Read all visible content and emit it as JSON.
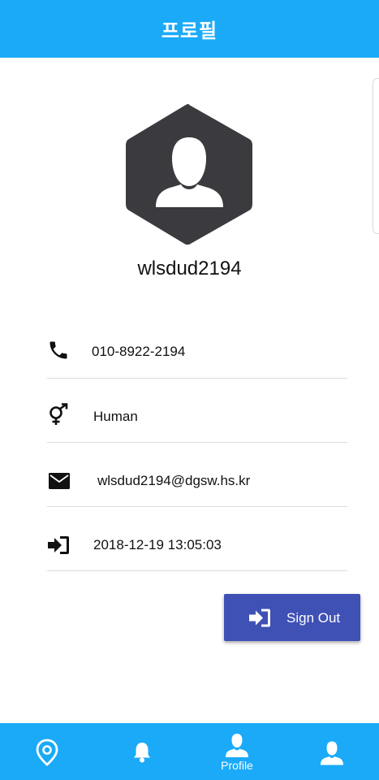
{
  "header": {
    "title": "프로필"
  },
  "profile": {
    "username": "wlsdud2194"
  },
  "details": {
    "phone": "010-8922-2194",
    "gender": "Human",
    "email": "wlsdud2194@dgsw.hs.kr",
    "last_login": "2018-12-19 13:05:03"
  },
  "actions": {
    "sign_out_label": "Sign Out"
  },
  "bottom_nav": {
    "items": [
      {
        "icon": "location-pin-icon",
        "label": ""
      },
      {
        "icon": "bell-icon",
        "label": ""
      },
      {
        "icon": "person-icon",
        "label": "Profile",
        "active": true
      },
      {
        "icon": "person-icon",
        "label": ""
      }
    ]
  },
  "colors": {
    "primary": "#1aaaf8",
    "button": "#3f51b5",
    "avatar": "#3a3a3f"
  }
}
